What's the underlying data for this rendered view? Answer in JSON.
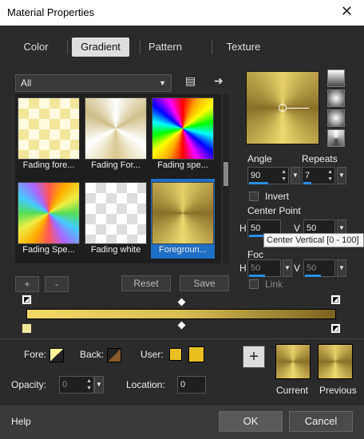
{
  "window": {
    "title": "Material Properties",
    "close": "✕"
  },
  "tabs": [
    {
      "label": "Color"
    },
    {
      "label": "Gradient"
    },
    {
      "label": "Pattern"
    },
    {
      "label": "Texture"
    }
  ],
  "category": {
    "value": "All"
  },
  "swatches": [
    {
      "label": "Fading fore..."
    },
    {
      "label": "Fading For..."
    },
    {
      "label": "Fading spe..."
    },
    {
      "label": "Fading Spe..."
    },
    {
      "label": "Fading white"
    },
    {
      "label": "Foregroun..."
    }
  ],
  "angle": {
    "label": "Angle",
    "value": "90"
  },
  "repeats": {
    "label": "Repeats",
    "value": "7"
  },
  "invert": {
    "label": "Invert"
  },
  "center_point": {
    "label": "Center Point",
    "h": "50",
    "v": "50",
    "h_label": "H",
    "v_label": "V"
  },
  "tooltip": "Center Vertical [0 - 100]",
  "focal": {
    "label": "Foc",
    "h": "50",
    "v": "50",
    "h_label": "H",
    "v_label": "V"
  },
  "link": {
    "label": "Link"
  },
  "editor": {
    "add": "+",
    "remove": "-",
    "reset": "Reset",
    "save": "Save"
  },
  "fore": {
    "label": "Fore:"
  },
  "back": {
    "label": "Back:"
  },
  "user": {
    "label": "User:"
  },
  "opacity": {
    "label": "Opacity:",
    "value": "0"
  },
  "location": {
    "label": "Location:",
    "value": "0"
  },
  "current": {
    "label": "Current"
  },
  "previous": {
    "label": "Previous"
  },
  "plus": "+",
  "footer": {
    "help": "Help",
    "ok": "OK",
    "cancel": "Cancel"
  },
  "colors": {
    "accent": "#1f6fc4",
    "gold": "#d8be55",
    "user": "#e8c020"
  }
}
